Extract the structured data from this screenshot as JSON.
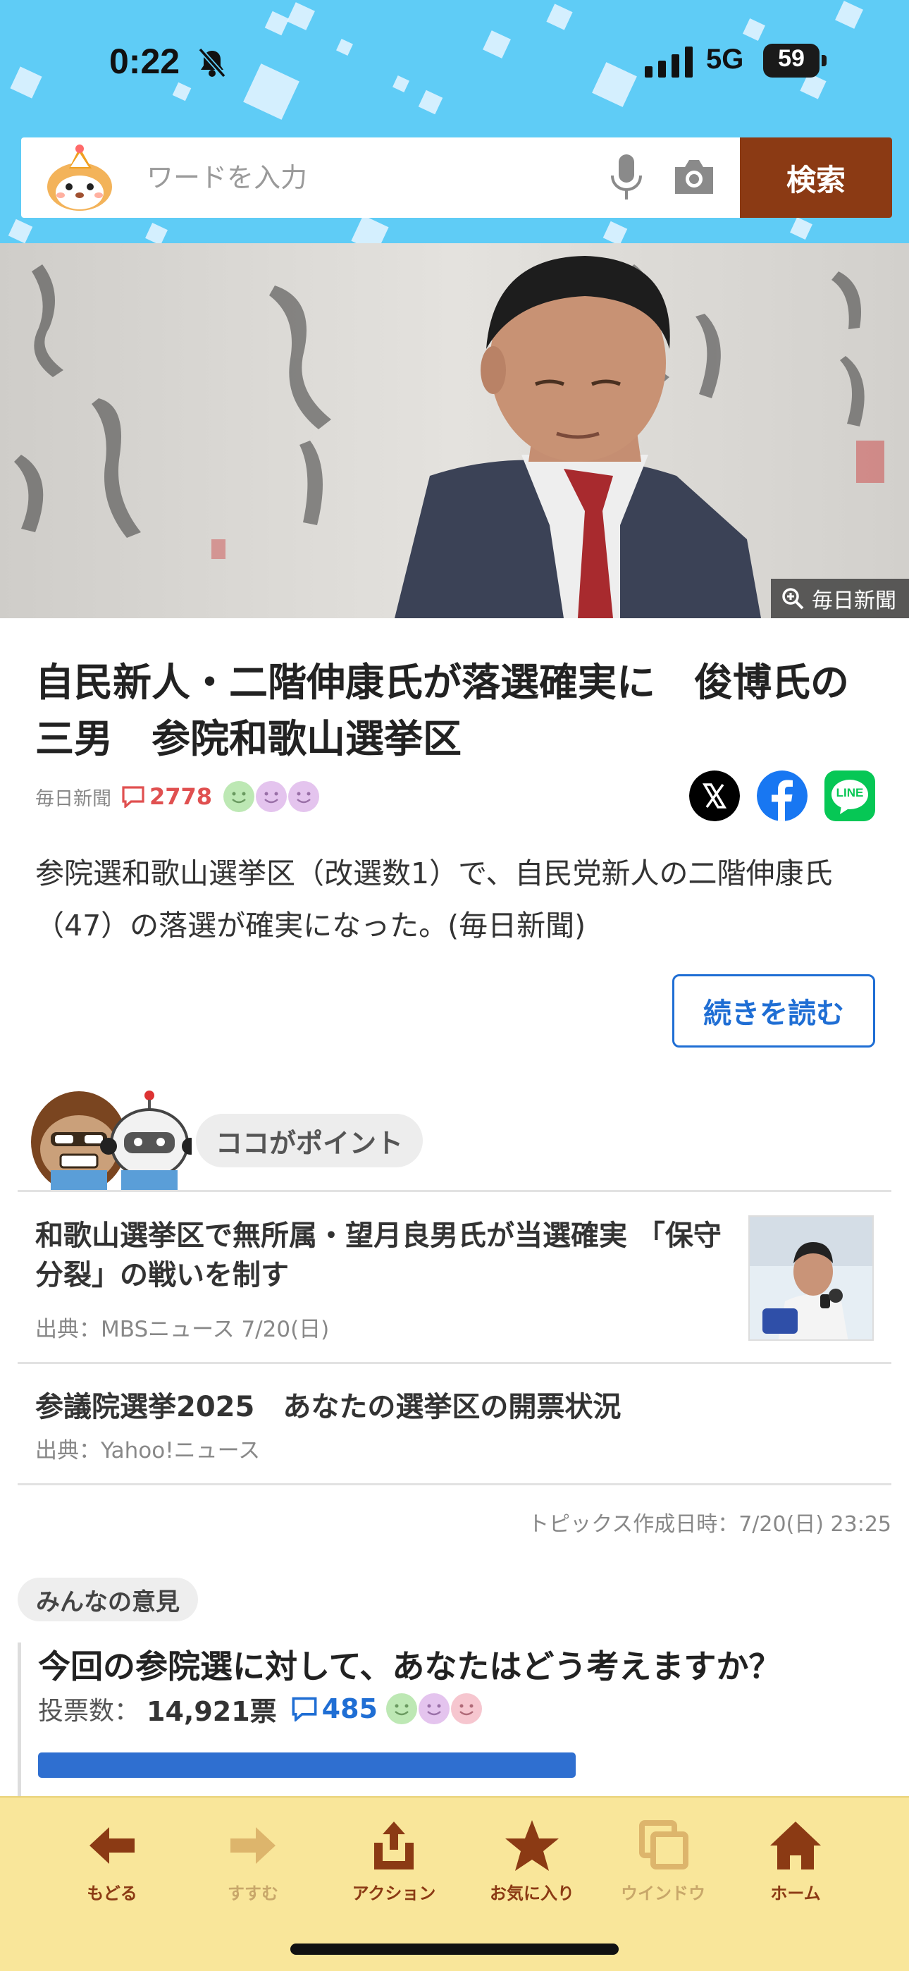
{
  "status_bar": {
    "time": "0:22",
    "network": "5G",
    "battery": "59"
  },
  "search": {
    "placeholder": "ワードを入力",
    "button_label": "検索"
  },
  "hero": {
    "credit": "毎日新聞"
  },
  "article": {
    "headline": "自民新人・二階伸康氏が落選確実に　俊博氏の三男　参院和歌山選挙区",
    "source": "毎日新聞",
    "comment_count": "2778",
    "summary": "参院選和歌山選挙区（改選数1）で、自民党新人の二階伸康氏（47）の落選が確実になった。(毎日新聞)",
    "read_more_label": "続きを読む"
  },
  "share": {
    "icons": [
      "x-icon",
      "facebook-icon",
      "line-icon"
    ],
    "line_label": "LINE"
  },
  "points": {
    "label": "ココがポイント",
    "items": [
      {
        "title": "和歌山選挙区で無所属・望月良男氏が当選確実 「保守分裂」の戦いを制す",
        "source": "出典：MBSニュース  7/20(日)"
      },
      {
        "title": "参議院選挙2025　あなたの選挙区の開票状況",
        "source": "出典：Yahoo!ニュース"
      }
    ],
    "created_at": "トピックス作成日時：7/20(日) 23:25"
  },
  "opinions": {
    "label": "みんなの意見",
    "question": "今回の参院選に対して、あなたはどう考えますか？",
    "votes_label": "投票数：",
    "votes_value": "14,921票",
    "comment_count": "485",
    "top_option_fraction": 0.79
  },
  "toolbar": {
    "items": [
      {
        "label": "もどる",
        "icon": "arrow-left-icon"
      },
      {
        "label": "すすむ",
        "icon": "arrow-right-icon"
      },
      {
        "label": "アクション",
        "icon": "share-icon"
      },
      {
        "label": "お気に入り",
        "icon": "star-icon"
      },
      {
        "label": "ウインドウ",
        "icon": "windows-icon"
      },
      {
        "label": "ホーム",
        "icon": "home-icon"
      }
    ]
  },
  "colors": {
    "sky": "#5fccf6",
    "search_button": "#8b3a14",
    "accent_blue": "#1f6ed4",
    "comment_red": "#e05050",
    "toolbar_bg": "#f9e69a"
  }
}
